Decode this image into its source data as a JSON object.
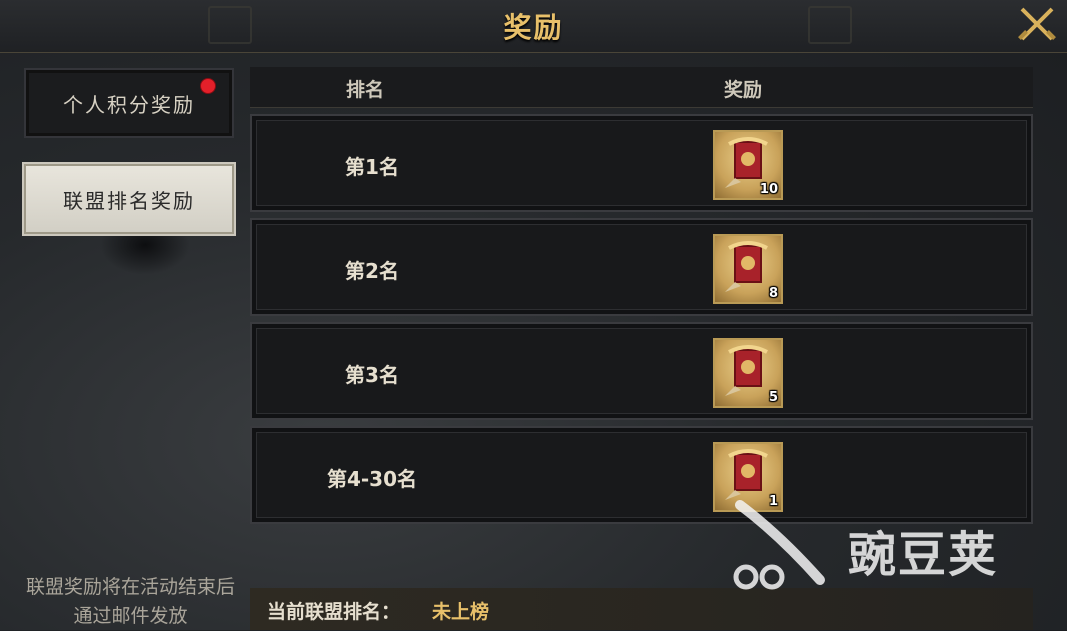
{
  "header": {
    "title": "奖励"
  },
  "sidebar": {
    "tabs": [
      {
        "label": "个人积分奖励",
        "has_notification": true
      },
      {
        "label": "联盟排名奖励",
        "selected": true
      }
    ],
    "note": "联盟奖励将在活动结束后通过邮件发放"
  },
  "table": {
    "columns": [
      "排名",
      "奖励"
    ],
    "rows": [
      {
        "rank": "第1名",
        "reward_icon": "banner-item-icon",
        "count": "10"
      },
      {
        "rank": "第2名",
        "reward_icon": "banner-item-icon",
        "count": "8"
      },
      {
        "rank": "第3名",
        "reward_icon": "banner-item-icon",
        "count": "5"
      },
      {
        "rank": "第4-30名",
        "reward_icon": "banner-item-icon",
        "count": "1"
      }
    ]
  },
  "footer": {
    "label": "当前联盟排名：",
    "value": "未上榜"
  },
  "watermark": {
    "text": "豌豆荚"
  },
  "colors": {
    "gold": "#e8c06a",
    "notification": "#e3202a",
    "active_tab": "#e2dfd6"
  }
}
